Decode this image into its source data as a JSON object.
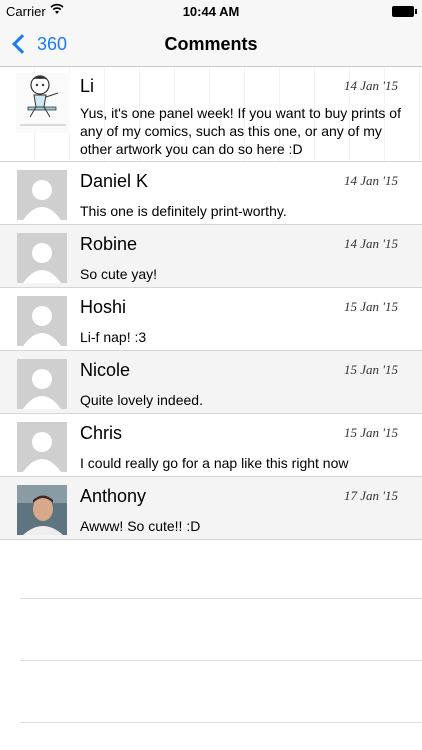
{
  "status_bar": {
    "carrier": "Carrier",
    "time": "10:44 AM"
  },
  "nav": {
    "back_label": "360",
    "title": "Comments"
  },
  "comments": [
    {
      "name": "Li",
      "date": "14 Jan '15",
      "text": "Yus, it's one panel week! If you want to buy prints of any of my comics, such as this one, or any of my other artwork you can do so here :D",
      "avatar": "doodle-avatar"
    },
    {
      "name": "Daniel K",
      "date": "14 Jan '15",
      "text": "This one is definitely print-worthy.",
      "avatar": "default-avatar"
    },
    {
      "name": "Robine",
      "date": "14 Jan '15",
      "text": "So cute yay!",
      "avatar": "default-avatar"
    },
    {
      "name": "Hoshi",
      "date": "15 Jan '15",
      "text": "Li-f nap! :3",
      "avatar": "default-avatar"
    },
    {
      "name": "Nicole",
      "date": "15 Jan '15",
      "text": "Quite lovely indeed.",
      "avatar": "default-avatar"
    },
    {
      "name": "Chris",
      "date": "15 Jan '15",
      "text": "I could really go for a nap like this right now",
      "avatar": "default-avatar"
    },
    {
      "name": "Anthony",
      "date": "17 Jan '15",
      "text": "Awww! So cute!! :D",
      "avatar": "photo-avatar"
    }
  ],
  "colors": {
    "accent": "#1a7cf3",
    "placeholder_avatar": "#cfcfcf"
  }
}
